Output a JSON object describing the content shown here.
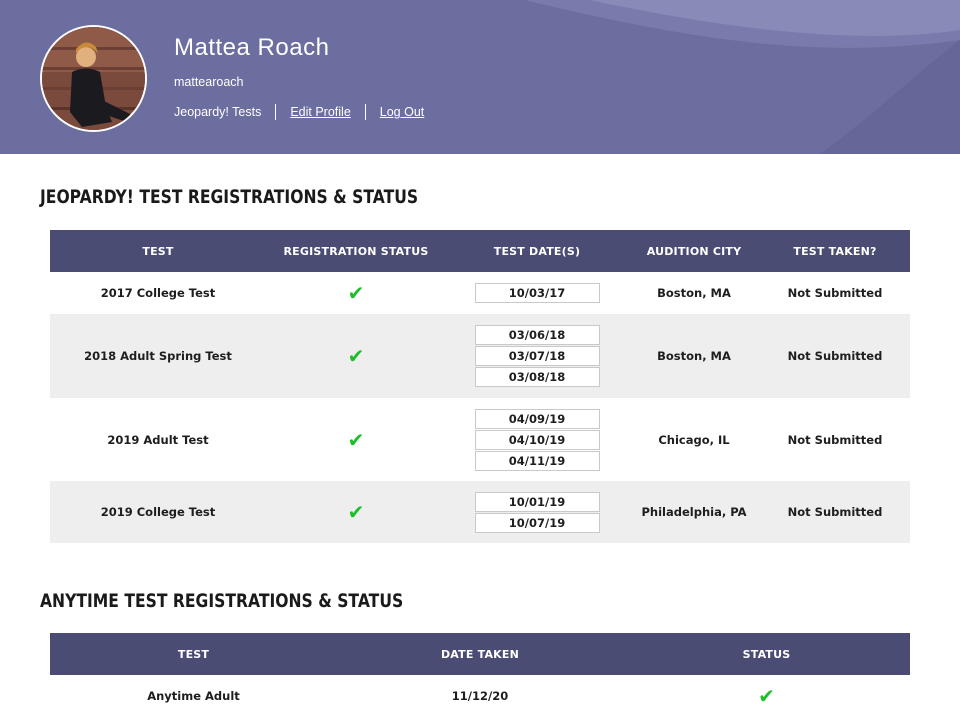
{
  "profile": {
    "name": "Mattea Roach",
    "username": "mattearoach",
    "links": [
      "Jeopardy! Tests",
      "Edit Profile",
      "Log Out"
    ]
  },
  "jeopardy": {
    "title": "JEOPARDY! TEST REGISTRATIONS & STATUS",
    "columns": [
      "TEST",
      "REGISTRATION STATUS",
      "TEST DATE(S)",
      "AUDITION CITY",
      "TEST TAKEN?"
    ],
    "rows": [
      {
        "test": "2017 College Test",
        "status_icon": "check-icon",
        "dates": [
          "10/03/17"
        ],
        "city": "Boston, MA",
        "taken": "Not Submitted"
      },
      {
        "test": "2018 Adult Spring Test",
        "status_icon": "check-icon",
        "dates": [
          "03/06/18",
          "03/07/18",
          "03/08/18"
        ],
        "city": "Boston, MA",
        "taken": "Not Submitted"
      },
      {
        "test": "2019 Adult Test",
        "status_icon": "check-icon",
        "dates": [
          "04/09/19",
          "04/10/19",
          "04/11/19"
        ],
        "city": "Chicago, IL",
        "taken": "Not Submitted"
      },
      {
        "test": "2019 College Test",
        "status_icon": "check-icon",
        "dates": [
          "10/01/19",
          "10/07/19"
        ],
        "city": "Philadelphia, PA",
        "taken": "Not Submitted"
      }
    ]
  },
  "anytime": {
    "title": "ANYTIME TEST REGISTRATIONS & STATUS",
    "columns": [
      "TEST",
      "DATE TAKEN",
      "STATUS"
    ],
    "rows": [
      {
        "test": "Anytime Adult",
        "date": "11/12/20",
        "status_icon": "check-icon"
      }
    ]
  },
  "colors": {
    "header_bg": "#6b6e9f",
    "table_header_bg": "#4a4c73",
    "row_alt_bg": "#eeeeee",
    "check": "#1ebe2b"
  }
}
